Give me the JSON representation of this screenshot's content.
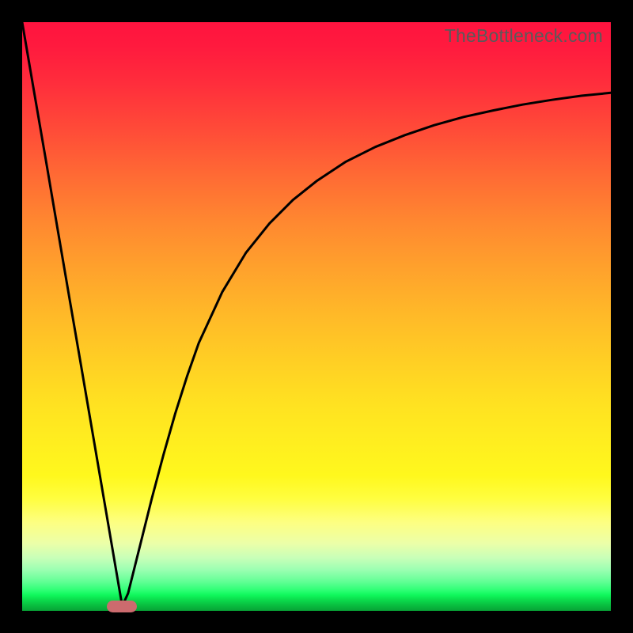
{
  "watermark": "TheBottleneck.com",
  "colors": {
    "frame": "#000000",
    "curve": "#000000",
    "marker": "#cc6b6e"
  },
  "chart_data": {
    "type": "line",
    "title": "",
    "xlabel": "",
    "ylabel": "",
    "xlim": [
      0,
      100
    ],
    "ylim": [
      0,
      100
    ],
    "grid": false,
    "legend": false,
    "note": "Axes are unlabeled; values estimated from pixel positions on a 0–100 normalized scale. Curve dips from top-left to a minimum near x≈17 (y≈0) then rises asymptotically toward ~y≈88 at the right edge.",
    "series": [
      {
        "name": "bottleneck-curve",
        "x": [
          0,
          2,
          4,
          6,
          8,
          10,
          12,
          14,
          16,
          17,
          18,
          20,
          22,
          24,
          26,
          28,
          30,
          34,
          38,
          42,
          46,
          50,
          55,
          60,
          65,
          70,
          75,
          80,
          85,
          90,
          95,
          100
        ],
        "y": [
          100,
          88.3,
          76.7,
          65.0,
          53.3,
          41.7,
          30.0,
          18.3,
          6.7,
          0.8,
          3.0,
          11.0,
          19.0,
          26.5,
          33.5,
          39.8,
          45.5,
          54.2,
          60.8,
          65.8,
          69.8,
          73.0,
          76.3,
          78.8,
          80.8,
          82.5,
          83.9,
          85.0,
          86.0,
          86.8,
          87.5,
          88.0
        ]
      }
    ],
    "marker": {
      "x": 17,
      "y": 0.8,
      "shape": "pill"
    }
  }
}
